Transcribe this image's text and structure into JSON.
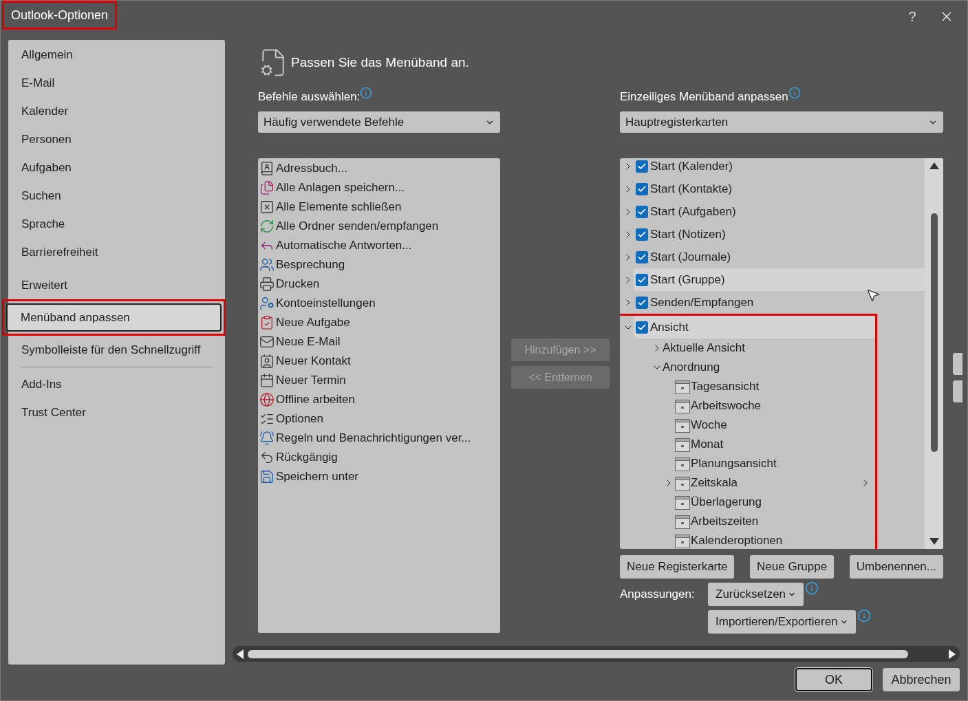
{
  "window": {
    "title": "Outlook-Optionen",
    "title_highlighted": true,
    "help": "?"
  },
  "sidebar": {
    "groups": [
      [
        {
          "label": "Allgemein",
          "selected": false,
          "highlighted": false
        },
        {
          "label": "E-Mail",
          "selected": false,
          "highlighted": false
        },
        {
          "label": "Kalender",
          "selected": false,
          "highlighted": false
        },
        {
          "label": "Personen",
          "selected": false,
          "highlighted": false
        },
        {
          "label": "Aufgaben",
          "selected": false,
          "highlighted": false
        },
        {
          "label": "Suchen",
          "selected": false,
          "highlighted": false
        },
        {
          "label": "Sprache",
          "selected": false,
          "highlighted": false
        },
        {
          "label": "Barrierefreiheit",
          "selected": false,
          "highlighted": false
        }
      ],
      [
        {
          "label": "Erweitert",
          "selected": false,
          "highlighted": false
        },
        {
          "label": "Menüband anpassen",
          "selected": true,
          "highlighted": true
        },
        {
          "label": "Symbolleiste für den Schnellzugriff",
          "selected": false,
          "highlighted": false
        }
      ],
      [
        {
          "label": "Add-Ins",
          "selected": false,
          "highlighted": false
        },
        {
          "label": "Trust Center",
          "selected": false,
          "highlighted": false
        }
      ]
    ]
  },
  "header": "Passen Sie das Menüband an.",
  "commands": {
    "label": "Befehle auswählen:",
    "dropdown": "Häufig verwendete Befehle",
    "items": [
      "Adressbuch...",
      "Alle Anlagen speichern...",
      "Alle Elemente schließen",
      "Alle Ordner senden/empfangen",
      "Automatische Antworten...",
      "Besprechung",
      "Drucken",
      "Kontoeinstellungen",
      "Neue Aufgabe",
      "Neue E-Mail",
      "Neuer Kontakt",
      "Neuer Termin",
      "Offline arbeiten",
      "Optionen",
      "Regeln und Benachrichtigungen ver...",
      "Rückgängig",
      "Speichern unter"
    ]
  },
  "transfer_buttons": [
    {
      "label": "Hinzufügen >>",
      "disabled": true
    },
    {
      "label": "<< Entfernen",
      "disabled": true
    }
  ],
  "ribbon": {
    "label": "Einzeiliges Menüband anpassen",
    "dropdown": "Hauptregisterkarten",
    "tree": [
      {
        "label": "Start (Kalender)",
        "checked": true,
        "expanded": false,
        "selected": false,
        "highlighted": false
      },
      {
        "label": "Start (Kontakte)",
        "checked": true,
        "expanded": false,
        "selected": false,
        "highlighted": false
      },
      {
        "label": "Start (Aufgaben)",
        "checked": true,
        "expanded": false,
        "selected": false,
        "highlighted": false
      },
      {
        "label": "Start (Notizen)",
        "checked": true,
        "expanded": false,
        "selected": false,
        "highlighted": false
      },
      {
        "label": "Start (Journale)",
        "checked": true,
        "expanded": false,
        "selected": false,
        "highlighted": false
      },
      {
        "label": "Start (Gruppe)",
        "checked": true,
        "expanded": false,
        "selected": true,
        "highlighted": false
      },
      {
        "label": "Senden/Empfangen",
        "checked": true,
        "expanded": false,
        "selected": false,
        "highlighted": false
      },
      {
        "label": "Ansicht",
        "checked": true,
        "expanded": true,
        "selected": true,
        "highlighted": true,
        "children": [
          {
            "label": "Aktuelle Ansicht",
            "expanded": false
          },
          {
            "label": "Anordnung",
            "expanded": true,
            "children": [
              {
                "label": "Tagesansicht"
              },
              {
                "label": "Arbeitswoche"
              },
              {
                "label": "Woche"
              },
              {
                "label": "Monat"
              },
              {
                "label": "Planungsansicht"
              },
              {
                "label": "Zeitskala",
                "expanded": false,
                "submenu": true
              },
              {
                "label": "Überlagerung"
              },
              {
                "label": "Arbeitszeiten"
              },
              {
                "label": "Kalenderoptionen"
              }
            ]
          }
        ]
      }
    ]
  },
  "tree_buttons": [
    "Neue Registerkarte",
    "Neue Gruppe",
    "Umbenennen..."
  ],
  "customizations": {
    "label": "Anpassungen:",
    "buttons": [
      "Zurücksetzen",
      "Importieren/Exportieren"
    ]
  },
  "footer_buttons": [
    {
      "label": "OK",
      "default": true
    },
    {
      "label": "Abbrechen",
      "default": false
    }
  ]
}
